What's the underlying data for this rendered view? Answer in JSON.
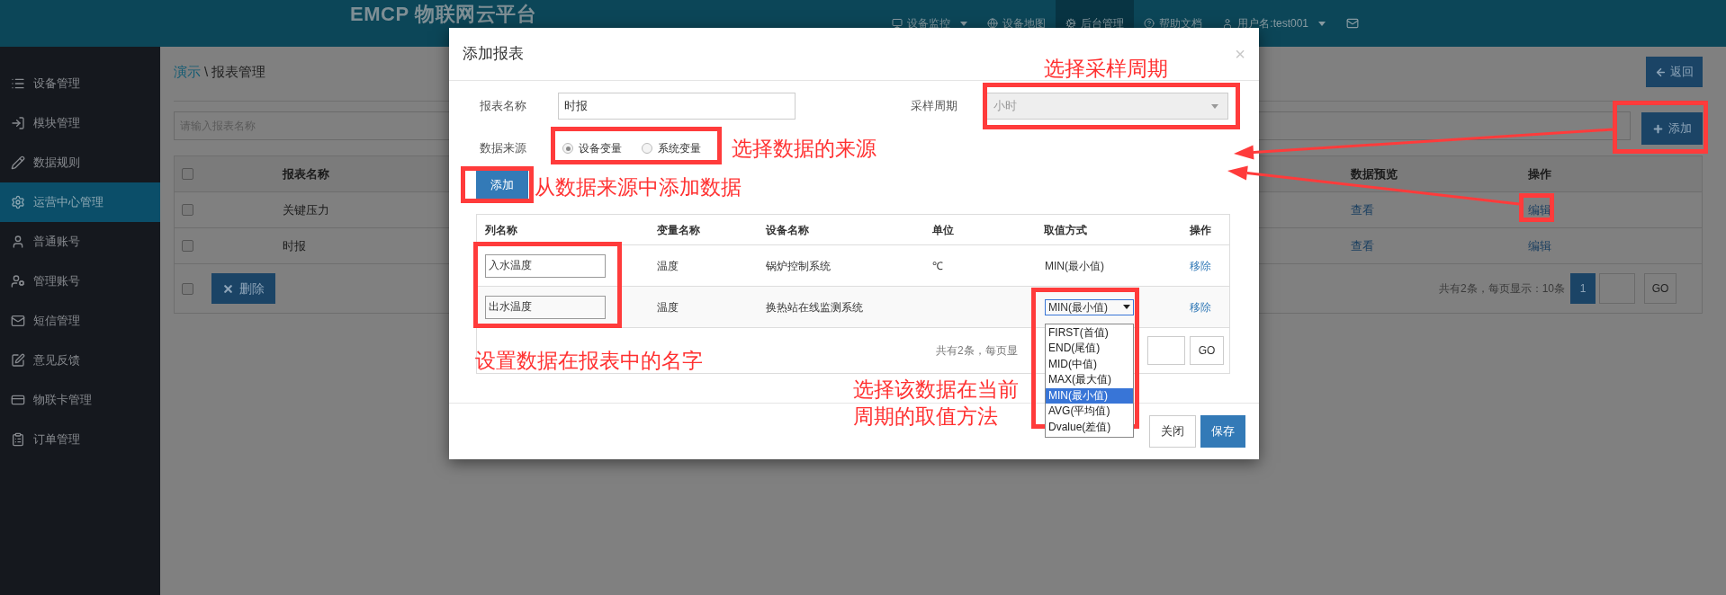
{
  "top_nav": {
    "logo": "EMCP 物联网云平台",
    "items": [
      {
        "label": "设备监控",
        "selected": false,
        "has_menu": true
      },
      {
        "label": "设备地图",
        "selected": false,
        "has_menu": false
      },
      {
        "label": "后台管理",
        "selected": true,
        "has_menu": false
      },
      {
        "label": "帮助文档",
        "selected": false,
        "has_menu": false
      },
      {
        "label": "用户名:test001",
        "selected": false,
        "has_menu": true
      }
    ]
  },
  "sidebar": {
    "items": [
      {
        "label": "设备管理",
        "selected": false
      },
      {
        "label": "模块管理",
        "selected": false
      },
      {
        "label": "数据规则",
        "selected": false
      },
      {
        "label": "运营中心管理",
        "selected": true
      },
      {
        "label": "普通账号",
        "selected": false
      },
      {
        "label": "管理账号",
        "selected": false
      },
      {
        "label": "短信管理",
        "selected": false
      },
      {
        "label": "意见反馈",
        "selected": false
      },
      {
        "label": "物联卡管理",
        "selected": false
      },
      {
        "label": "订单管理",
        "selected": false
      }
    ]
  },
  "page": {
    "breadcrumb": {
      "link": "演示",
      "separator": "\\",
      "current": "报表管理"
    },
    "back_button": "返回",
    "search": {
      "placeholder": "请输入报表名称"
    },
    "add_button": "添加",
    "table": {
      "columns": [
        "报表名称",
        "数据预览",
        "操作"
      ],
      "header_checked": false,
      "rows": [
        {
          "checked": false,
          "name": "关键压力",
          "preview": "查看",
          "action": "编辑"
        },
        {
          "checked": false,
          "name": "时报",
          "preview": "查看",
          "action": "编辑"
        }
      ]
    },
    "footer_checked": false,
    "delete_button": "删除",
    "pagination": {
      "summary": "共有2条，每页显示：10条",
      "pages": [
        {
          "label": "1",
          "selected": true
        }
      ],
      "go": "GO"
    }
  },
  "modal": {
    "title": "添加报表",
    "close": "×",
    "form": {
      "name_label": "报表名称",
      "name_value": "时报",
      "period_label": "采样周期",
      "period_value": "小时",
      "period_disabled": true,
      "source_label": "数据来源",
      "sources": [
        {
          "label": "设备变量",
          "selected": true
        },
        {
          "label": "系统变量",
          "selected": false
        }
      ]
    },
    "add_button": "添加",
    "table": {
      "columns": [
        "列名称",
        "变量名称",
        "设备名称",
        "单位",
        "取值方式",
        "操作"
      ],
      "rows": [
        {
          "column_name": "入水温度",
          "variable": "温度",
          "device": "锅炉控制系统",
          "unit": "℃",
          "method": {
            "kind": "text",
            "value": "MIN(最小值)"
          },
          "action": "移除"
        },
        {
          "column_name": "出水温度",
          "variable": "温度",
          "device": "换热站在线监测系统",
          "method": {
            "kind": "select",
            "value": "MIN(最小值)",
            "expanded": true,
            "options": [
              {
                "label": "FIRST(首值)",
                "selected": false
              },
              {
                "label": "END(尾值)",
                "selected": false
              },
              {
                "label": "MID(中值)",
                "selected": false
              },
              {
                "label": "MAX(最大值)",
                "selected": false
              },
              {
                "label": "MIN(最小值)",
                "selected": true
              },
              {
                "label": "AVG(平均值)",
                "selected": false
              },
              {
                "label": "Dvalue(差值)",
                "selected": false
              }
            ]
          },
          "action": "移除"
        }
      ],
      "summary": "共有2条，每页显",
      "go": "GO"
    },
    "buttons": [
      {
        "label": "关闭",
        "kind": "default"
      },
      {
        "label": "保存",
        "kind": "primary"
      }
    ]
  },
  "annotations": [
    {
      "lines": [
        "选择采样周期"
      ]
    },
    {
      "lines": [
        "选择数据的来源"
      ]
    },
    {
      "lines": [
        "从数据来源中添加数据"
      ]
    },
    {
      "lines": [
        "设置数据在报表中的名字"
      ]
    },
    {
      "lines": [
        "选择该数据在当前",
        "周期的取值方法"
      ]
    }
  ]
}
